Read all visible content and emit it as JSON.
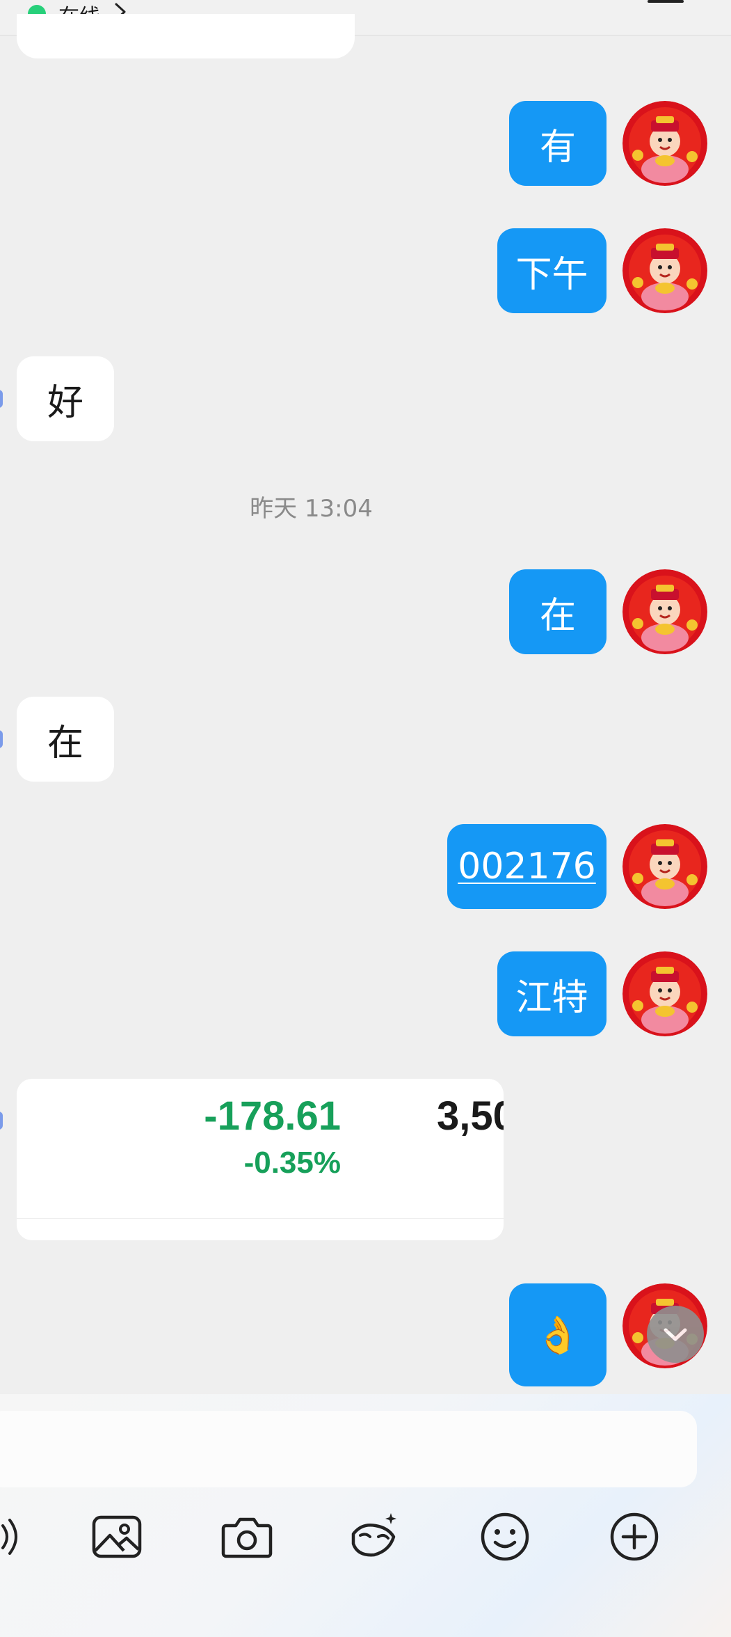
{
  "header": {
    "status_text": "在线"
  },
  "messages": {
    "m1": "有",
    "m2": "下午",
    "m3": "好",
    "timestamp": "昨天 13:04",
    "m4": "在",
    "m5": "在",
    "m6": "002176",
    "m7": "江特",
    "m8": "👌"
  },
  "stock_card": {
    "change": "-178.61",
    "change_pct": "-0.35%",
    "price_partial": "3,50"
  },
  "colors": {
    "outgoing_bubble": "#1598f5",
    "incoming_bubble": "#ffffff",
    "online": "#27d07a",
    "stock_down": "#17a05a"
  },
  "toolbar": {
    "icons": [
      "voice-icon",
      "image-icon",
      "camera-icon",
      "red-packet-icon",
      "emoji-icon",
      "plus-icon"
    ]
  }
}
